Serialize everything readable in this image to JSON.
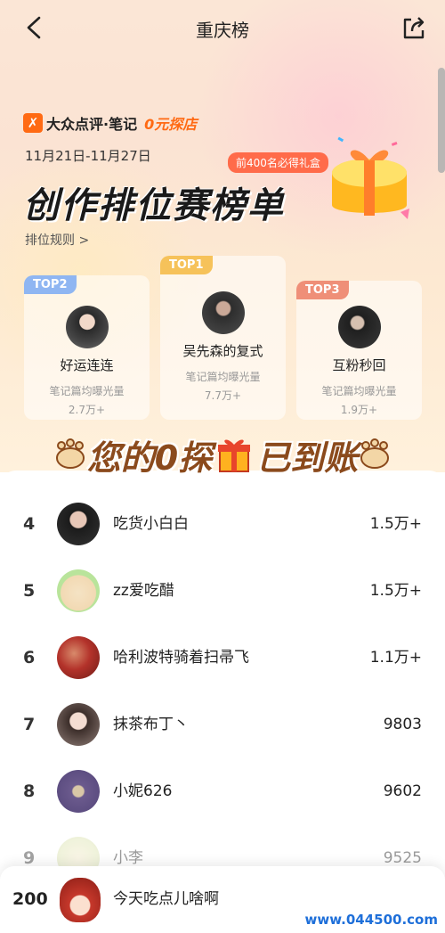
{
  "nav": {
    "title": "重庆榜"
  },
  "brand": {
    "logo_char": "✗",
    "name": "大众点评·笔记",
    "tag": "0元探店"
  },
  "header": {
    "date_range": "11月21日-11月27日",
    "reward_badge": "前400名必得礼盒",
    "title": "创作排位赛榜单",
    "rules_link": "排位规则 >"
  },
  "podium": [
    {
      "rank_label": "TOP2",
      "name": "好运连连",
      "metric_label": "笔记篇均曝光量",
      "metric_value": "2.7万+"
    },
    {
      "rank_label": "TOP1",
      "name": "吴先森的复式",
      "metric_label": "笔记篇均曝光量",
      "metric_value": "7.7万+"
    },
    {
      "rank_label": "TOP3",
      "name": "互粉秒回",
      "metric_label": "笔记篇均曝光量",
      "metric_value": "1.9万+"
    }
  ],
  "banner": {
    "left_text": "您的0探",
    "right_text": "已到账"
  },
  "ranking": [
    {
      "rank": "4",
      "name": "吃货小白白",
      "value": "1.5万+"
    },
    {
      "rank": "5",
      "name": "zz爱吃醋",
      "value": "1.5万+"
    },
    {
      "rank": "6",
      "name": "哈利波特骑着扫帚飞",
      "value": "1.1万+"
    },
    {
      "rank": "7",
      "name": "抹茶布丁丶",
      "value": "9803"
    },
    {
      "rank": "8",
      "name": "小妮626",
      "value": "9602"
    },
    {
      "rank": "9",
      "name": "小李",
      "value": "9525"
    }
  ],
  "my_entry": {
    "rank": "200",
    "name": "今天吃点儿啥啊"
  },
  "watermark": "www.044500.com",
  "colors": {
    "accent": "#ff6a13",
    "badge": "#ff6b4a",
    "top1": "#f6c25a",
    "top2": "#8fb6f2",
    "top3": "#ef8f78"
  }
}
